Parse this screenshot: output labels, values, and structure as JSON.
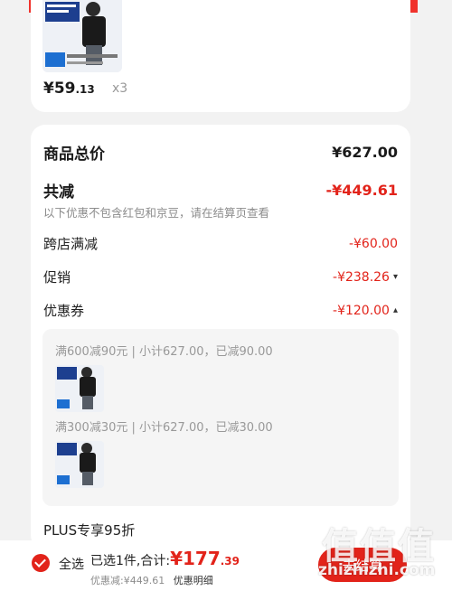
{
  "product": {
    "price_main": "¥59",
    "price_dec": ".13",
    "quantity": "x3"
  },
  "summary": {
    "total_label": "商品总价",
    "total_value": "¥627.00",
    "saved_label": "共减",
    "saved_value": "-¥449.61",
    "note": "以下优惠不包含红包和京豆，请在结算页查看",
    "rows": [
      {
        "label": "跨店满减",
        "value": "-¥60.00"
      },
      {
        "label": "促销",
        "value": "-¥238.26"
      },
      {
        "label": "优惠券",
        "value": "-¥120.00"
      }
    ],
    "coupons": [
      "满600减90元 | 小计627.00，已减90.00",
      "满300减30元 | 小计627.00，已减30.00"
    ],
    "plus_label": "PLUS专享95折"
  },
  "bottom": {
    "select_all": "全选",
    "selected_text": "已选1件,合计:",
    "total_main": "¥177",
    "total_dec": ".39",
    "discount_text": "优惠减:¥449.61",
    "detail_link": "优惠明细",
    "checkout_label": "去结算"
  },
  "watermark": {
    "logo": "值值值",
    "url": "zhizhizhi.com"
  },
  "colors": {
    "accent": "#e2231a",
    "banner": "#f0322c"
  }
}
